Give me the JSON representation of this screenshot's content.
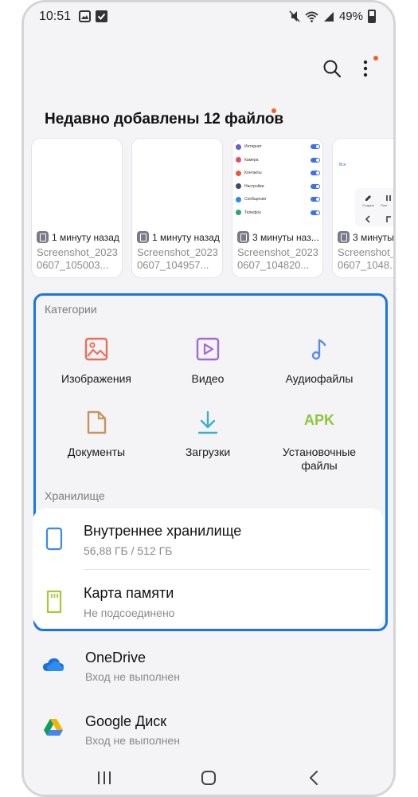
{
  "status_bar": {
    "time": "10:51",
    "battery": "49%",
    "left_icons": [
      "gallery-notification-icon",
      "check-notification-icon"
    ],
    "right_icons": [
      "mute-icon",
      "wifi-icon",
      "signal-icon",
      "battery-icon"
    ]
  },
  "toolbar": {
    "search_icon": "search-icon",
    "more_icon": "more-vertical-icon",
    "badge_color": "#f0602a"
  },
  "recent": {
    "title": "Недавно добавлены 12 файлов",
    "files": [
      {
        "time": "1 минуту назад",
        "name": "Screenshot_20230607_105003..."
      },
      {
        "time": "1 минуту назад",
        "name": "Screenshot_20230607_104957..."
      },
      {
        "time": "3 минуты наз...",
        "name": "Screenshot_20230607_104820..."
      },
      {
        "time": "3 минуты н",
        "name": "Screenshot_20230607_1048..."
      }
    ],
    "preview_3": [
      {
        "label": "Интернет",
        "color": "#6b5bd6"
      },
      {
        "label": "Камера",
        "color": "#e84a6a"
      },
      {
        "label": "Контакты",
        "color": "#e8593a"
      },
      {
        "label": "Настройки",
        "color": "#3a4a6a"
      },
      {
        "label": "Сообщения",
        "color": "#2a8ae8"
      },
      {
        "label": "Телефон",
        "color": "#2aa86a"
      }
    ],
    "preview_4": {
      "link": "Все",
      "labels": [
        "Создать",
        "Пом"
      ]
    }
  },
  "categories": {
    "title": "Категории",
    "items": [
      {
        "label": "Изображения",
        "icon": "image-icon",
        "color": "#e8705a"
      },
      {
        "label": "Видео",
        "icon": "video-icon",
        "color": "#a56ad8"
      },
      {
        "label": "Аудиофайлы",
        "icon": "music-note-icon",
        "color": "#5a8ae8"
      },
      {
        "label": "Документы",
        "icon": "document-icon",
        "color": "#c8945a"
      },
      {
        "label": "Загрузки",
        "icon": "download-icon",
        "color": "#3ab0c8"
      },
      {
        "label": "Установочные файлы",
        "icon": "apk-icon",
        "color": "#8ac83a",
        "icon_text": "APK"
      }
    ]
  },
  "storage": {
    "title": "Хранилище",
    "items": [
      {
        "title": "Внутреннее хранилище",
        "subtitle": "56,88 ГБ / 512 ГБ",
        "icon": "phone-storage-icon",
        "color": "#3a8ae8"
      },
      {
        "title": "Карта памяти",
        "subtitle": "Не подсоединено",
        "icon": "sd-card-icon",
        "color": "#a8c83a"
      }
    ]
  },
  "cloud": {
    "items": [
      {
        "title": "OneDrive",
        "subtitle": "Вход не выполнен",
        "icon": "onedrive-icon"
      },
      {
        "title": "Google Диск",
        "subtitle": "Вход не выполнен",
        "icon": "google-drive-icon"
      }
    ]
  },
  "nav": {
    "icons": [
      "recents-icon",
      "home-icon",
      "back-icon"
    ]
  },
  "colors": {
    "highlight": "#1a74e8",
    "background": "#f4f4f6"
  }
}
